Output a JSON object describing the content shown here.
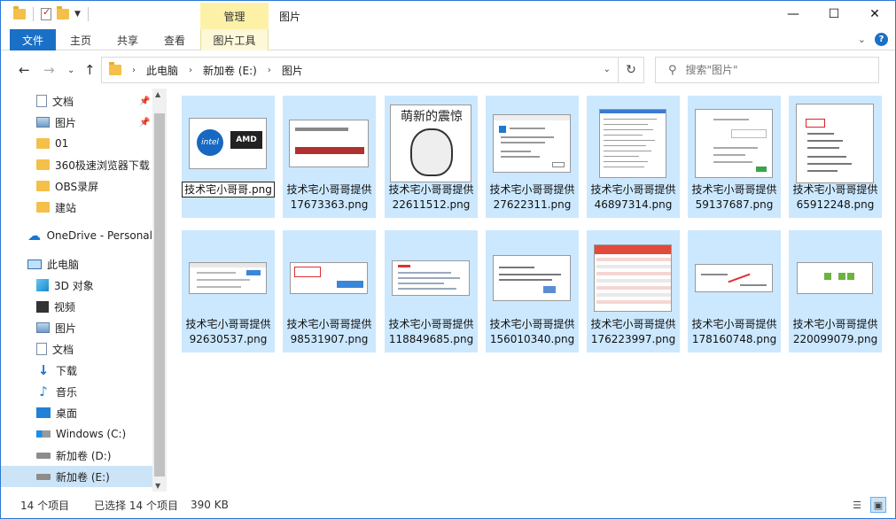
{
  "window": {
    "context_tab": "管理",
    "title": "图片",
    "controls": {
      "minimize": "—",
      "maximize": "☐",
      "close": "✕"
    }
  },
  "ribbon": {
    "tabs": [
      "文件",
      "主页",
      "共享",
      "查看",
      "图片工具"
    ],
    "expand_icon": "chevron-down-icon",
    "help": "?"
  },
  "address": {
    "crumbs": [
      "此电脑",
      "新加卷 (E:)",
      "图片"
    ],
    "search_placeholder": "搜索\"图片\""
  },
  "nav": {
    "items": [
      {
        "label": "文档",
        "icon": "document-icon",
        "pinned": true
      },
      {
        "label": "图片",
        "icon": "pictures-icon",
        "pinned": true
      },
      {
        "label": "01",
        "icon": "folder-icon"
      },
      {
        "label": "360极速浏览器下载",
        "icon": "folder-icon"
      },
      {
        "label": "OBS录屏",
        "icon": "folder-icon"
      },
      {
        "label": "建站",
        "icon": "folder-icon"
      },
      {
        "label": "OneDrive - Personal",
        "icon": "cloud-icon"
      },
      {
        "label": "此电脑",
        "icon": "computer-icon"
      },
      {
        "label": "3D 对象",
        "icon": "cube-icon"
      },
      {
        "label": "视频",
        "icon": "video-icon"
      },
      {
        "label": "图片",
        "icon": "pictures-icon"
      },
      {
        "label": "文档",
        "icon": "document-icon"
      },
      {
        "label": "下载",
        "icon": "download-icon"
      },
      {
        "label": "音乐",
        "icon": "music-icon"
      },
      {
        "label": "桌面",
        "icon": "desktop-icon"
      },
      {
        "label": "Windows (C:)",
        "icon": "windows-drive-icon"
      },
      {
        "label": "新加卷 (D:)",
        "icon": "drive-icon"
      },
      {
        "label": "新加卷 (E:)",
        "icon": "drive-icon",
        "selected": true
      }
    ]
  },
  "files": [
    {
      "name": "技术宅小哥哥.png",
      "renaming": true
    },
    {
      "name": "技术宅小哥哥提供17673363.png"
    },
    {
      "name": "技术宅小哥哥提供22611512.png",
      "thumb_caption": "萌新的震惊"
    },
    {
      "name": "技术宅小哥哥提供27622311.png"
    },
    {
      "name": "技术宅小哥哥提供46897314.png"
    },
    {
      "name": "技术宅小哥哥提供59137687.png"
    },
    {
      "name": "技术宅小哥哥提供65912248.png"
    },
    {
      "name": "技术宅小哥哥提供92630537.png"
    },
    {
      "name": "技术宅小哥哥提供98531907.png"
    },
    {
      "name": "技术宅小哥哥提供118849685.png"
    },
    {
      "name": "技术宅小哥哥提供156010340.png"
    },
    {
      "name": "技术宅小哥哥提供176223997.png"
    },
    {
      "name": "技术宅小哥哥提供178160748.png"
    },
    {
      "name": "技术宅小哥哥提供220099079.png"
    }
  ],
  "status": {
    "count": "14 个项目",
    "selected": "已选择 14 个项目",
    "size": "390 KB"
  },
  "colors": {
    "accent": "#1a70c7",
    "selection": "#cce8ff",
    "context_tab": "#fdf1a8"
  }
}
